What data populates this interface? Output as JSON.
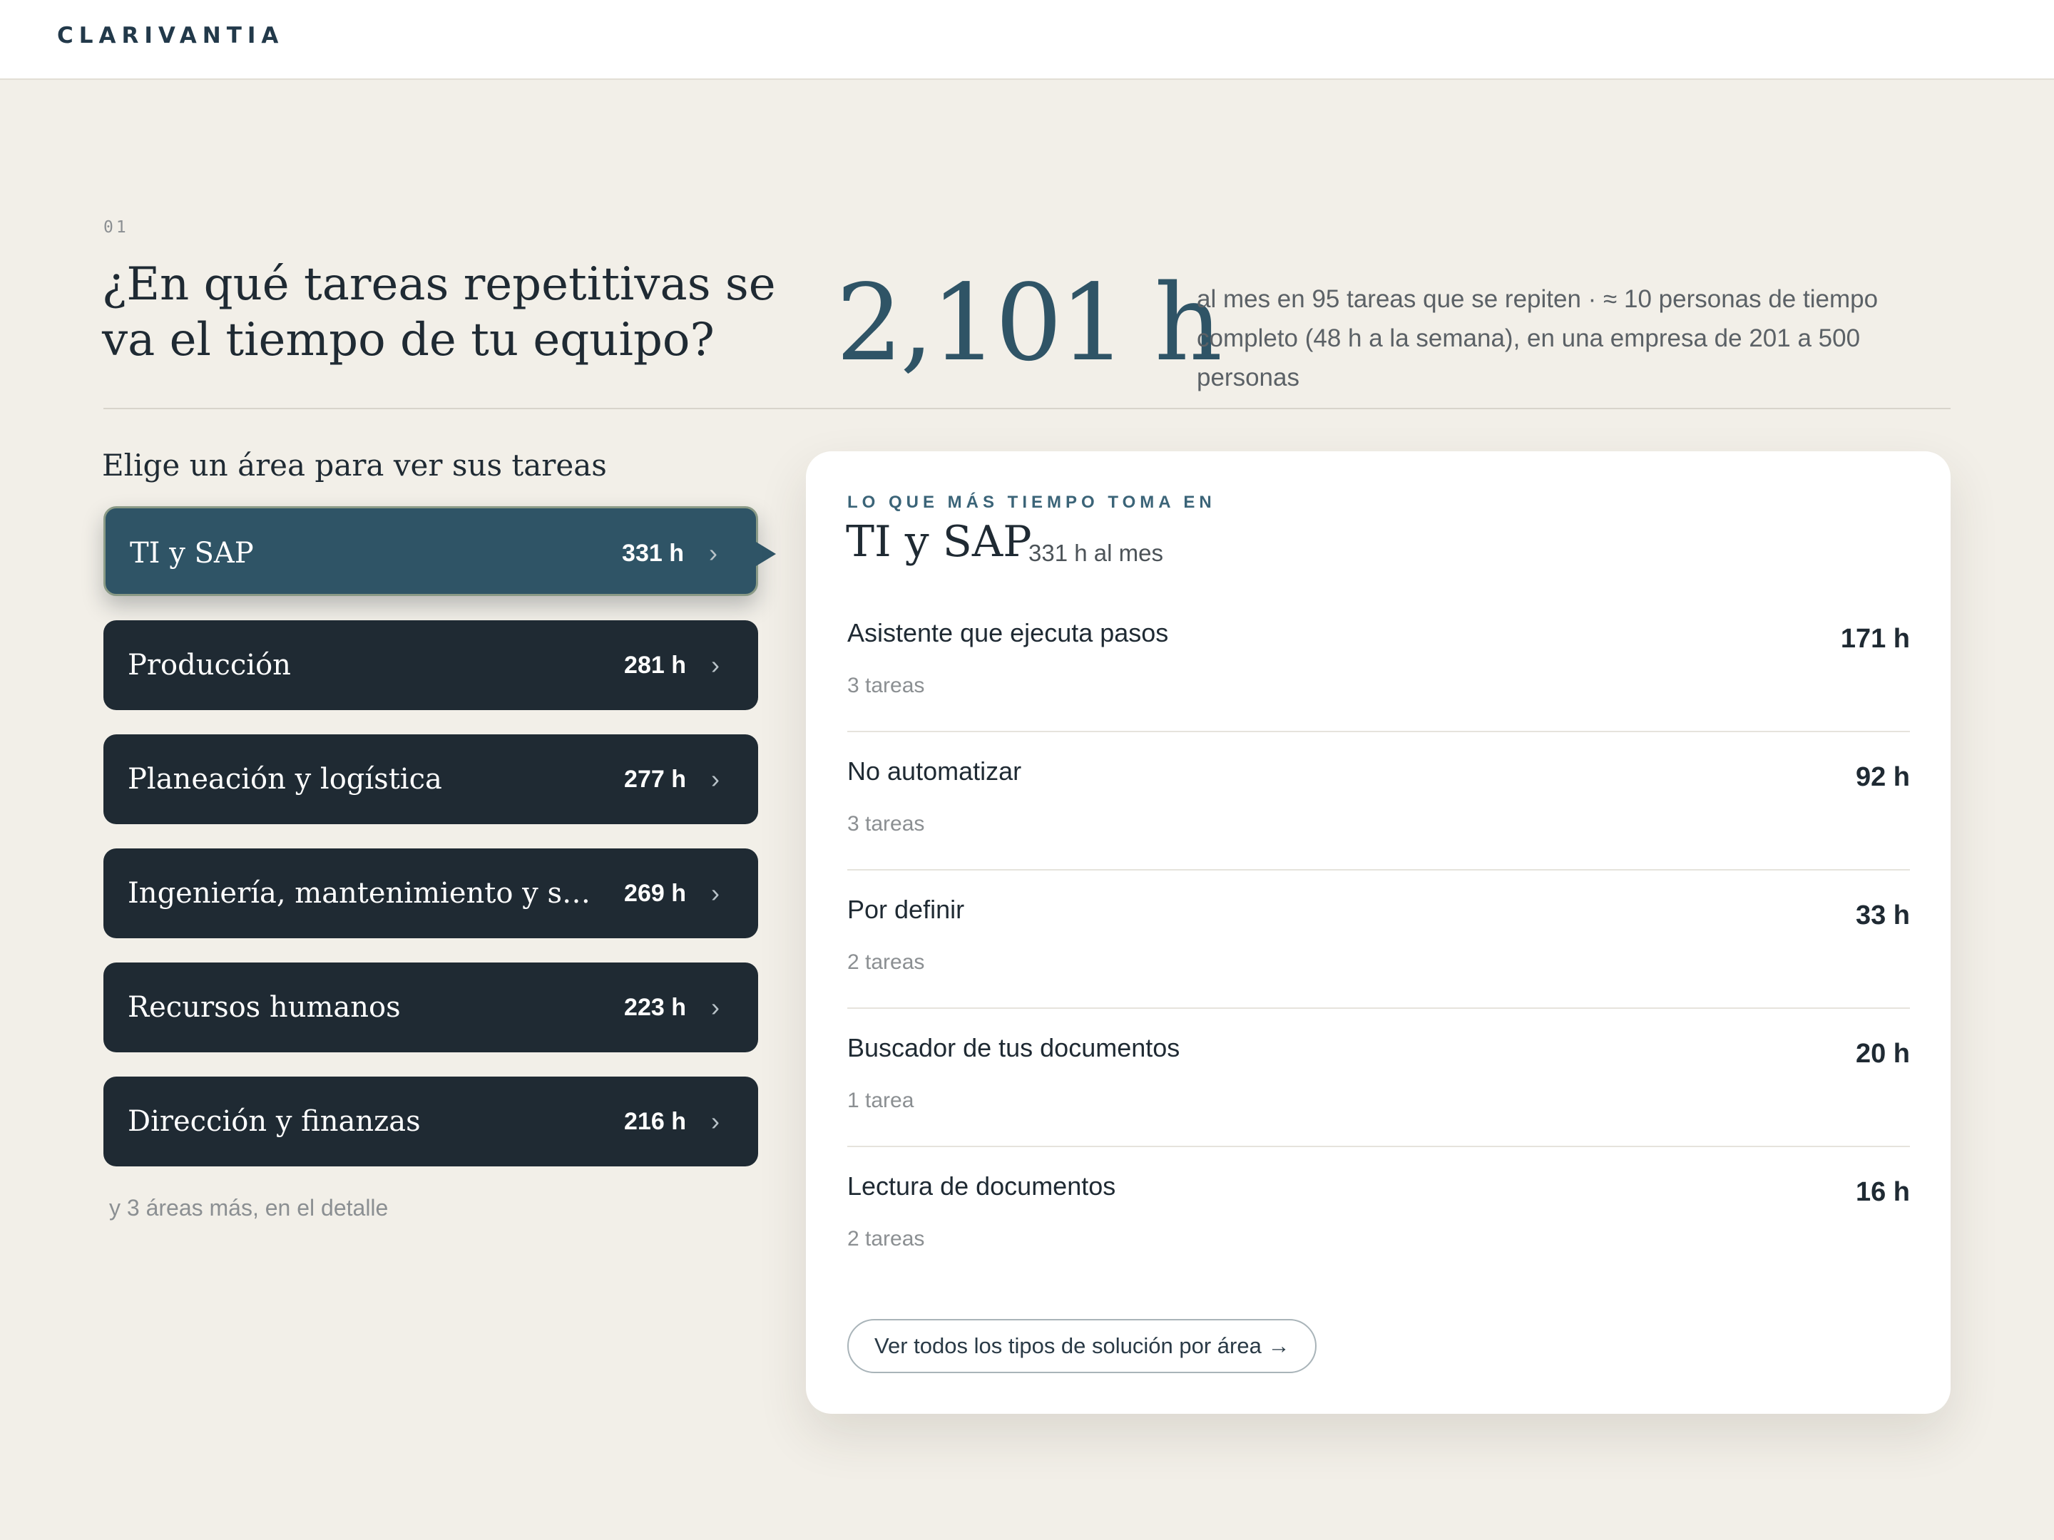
{
  "header": {
    "brand": "CLARIVANTIA"
  },
  "section": {
    "number": "01",
    "title": "¿En qué tareas repetitivas se va el tiempo de tu equipo?",
    "total_hours": "2,101 h",
    "summary": "al mes en 95 tareas que se repiten · ≈ 10 personas de tiempo completo (48 h a la semana), en una empresa de 201 a 500 personas"
  },
  "areas": {
    "prompt": "Elige un área para ver sus tareas",
    "items": [
      {
        "label": "TI y SAP",
        "hours": "331 h",
        "active": true
      },
      {
        "label": "Producción",
        "hours": "281 h",
        "active": false
      },
      {
        "label": "Planeación y logística",
        "hours": "277 h",
        "active": false
      },
      {
        "label": "Ingeniería, mantenimiento y seguri…",
        "hours": "269 h",
        "active": false
      },
      {
        "label": "Recursos humanos",
        "hours": "223 h",
        "active": false
      },
      {
        "label": "Dirección y finanzas",
        "hours": "216 h",
        "active": false
      }
    ],
    "chevron": "›",
    "more": "y 3 áreas más, en el detalle"
  },
  "detail": {
    "eyebrow": "LO QUE MÁS TIEMPO TOMA EN",
    "title": "TI y SAP",
    "subtitle": "331 h al mes",
    "tasks": [
      {
        "name": "Asistente que ejecuta pasos",
        "count": "3 tareas",
        "hours": "171 h"
      },
      {
        "name": "No automatizar",
        "count": "3 tareas",
        "hours": "92 h"
      },
      {
        "name": "Por definir",
        "count": "2 tareas",
        "hours": "33 h"
      },
      {
        "name": "Buscador de tus documentos",
        "count": "1 tarea",
        "hours": "20 h"
      },
      {
        "name": "Lectura de documentos",
        "count": "2 tareas",
        "hours": "16 h"
      }
    ],
    "cta": "Ver todos los tipos de solución por área →"
  },
  "colors": {
    "background": "#f2efe8",
    "area_default": "#1f2a33",
    "area_active": "#2f5466",
    "accent_number": "#2f5466"
  }
}
